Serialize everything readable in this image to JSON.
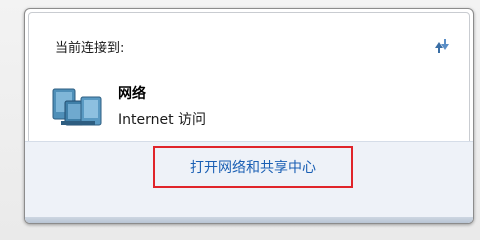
{
  "flyout": {
    "header_label": "当前连接到:",
    "network": {
      "name": "网络",
      "access": "Internet 访问",
      "icon": "network-computers-icon"
    },
    "refresh_icon": "refresh-arrows-icon",
    "footer_link": "打开网络和共享中心",
    "colors": {
      "link": "#1a5fb4",
      "highlight_box": "#e0242a",
      "footer_bg": "#eef2f8"
    }
  }
}
